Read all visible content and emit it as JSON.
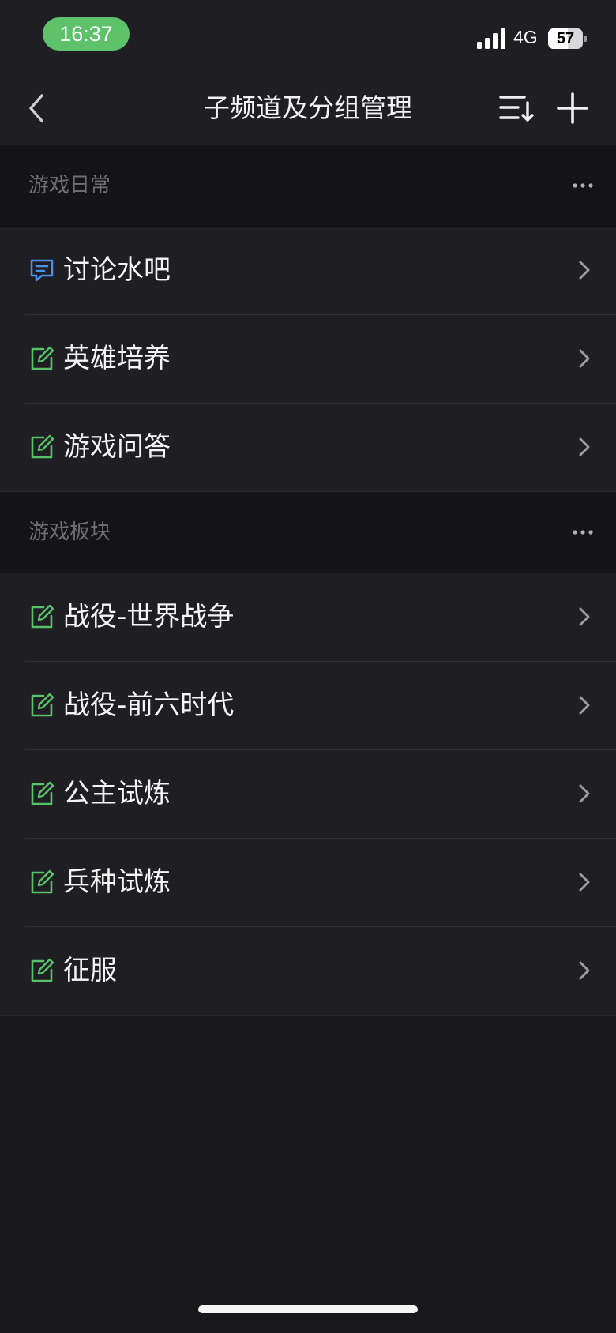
{
  "status_bar": {
    "time": "16:37",
    "network": "4G",
    "battery_level": "57",
    "battery_fraction": 0.57
  },
  "nav": {
    "title": "子频道及分组管理"
  },
  "groups": [
    {
      "title": "游戏日常",
      "items": [
        {
          "label": "讨论水吧",
          "icon": "chat-icon"
        },
        {
          "label": "英雄培养",
          "icon": "edit-icon"
        },
        {
          "label": "游戏问答",
          "icon": "edit-icon"
        }
      ]
    },
    {
      "title": "游戏板块",
      "items": [
        {
          "label": "战役-世界战争",
          "icon": "edit-icon"
        },
        {
          "label": "战役-前六时代",
          "icon": "edit-icon"
        },
        {
          "label": "公主试炼",
          "icon": "edit-icon"
        },
        {
          "label": "兵种试炼",
          "icon": "edit-icon"
        },
        {
          "label": "征服",
          "icon": "edit-icon"
        }
      ]
    }
  ],
  "colors": {
    "chat_icon": "#4a8fe8",
    "edit_icon": "#57c26a",
    "time_pill": "#5ec26a"
  }
}
